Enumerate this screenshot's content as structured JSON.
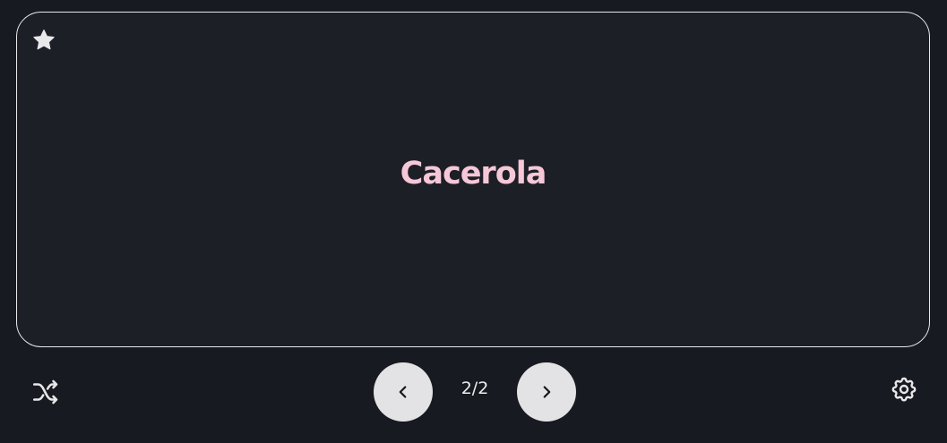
{
  "card": {
    "term": "Cacerola",
    "star_icon": "star-icon"
  },
  "controls": {
    "counter": "2/2",
    "shuffle_icon": "shuffle-icon",
    "prev_icon": "chevron-left-icon",
    "next_icon": "chevron-right-icon",
    "settings_icon": "gear-icon"
  },
  "colors": {
    "background": "#181a21",
    "card_background": "#1d1f27",
    "card_border": "#e9e9ec",
    "term_text": "#f6c8d7",
    "nav_button": "#e3e3e6"
  }
}
